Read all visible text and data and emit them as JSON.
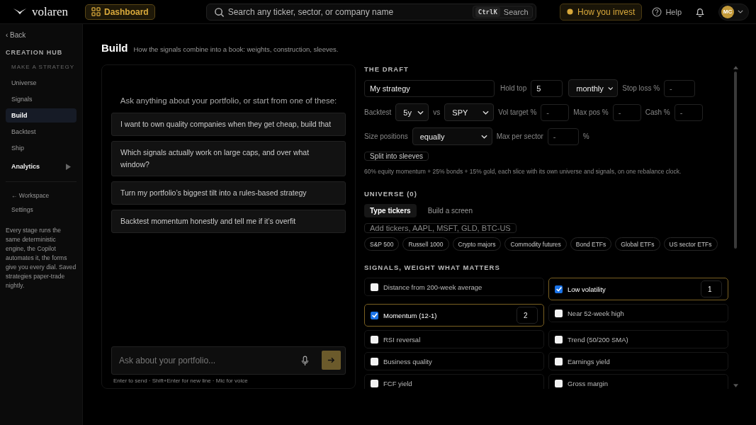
{
  "topbar": {
    "brand": "volaren",
    "dashboard_button": "Dashboard",
    "search": {
      "placeholder": "Search any ticker, sector, or company name",
      "shortcut": "CtrlK",
      "shortcut_label": "Search"
    },
    "invest_button": "How you invest",
    "help": "Help",
    "avatar": "MC"
  },
  "sidebar": {
    "back": "‹ Back",
    "section": "CREATION HUB",
    "subsection": "MAKE A STRATEGY",
    "items": [
      {
        "label": "Universe",
        "selected": false
      },
      {
        "label": "Signals",
        "selected": false
      },
      {
        "label": "Build",
        "selected": true
      },
      {
        "label": "Backtest",
        "selected": false
      },
      {
        "label": "Ship",
        "selected": false
      }
    ],
    "analytics": "Analytics",
    "links": [
      "← Workspace",
      "Settings"
    ],
    "note": "Every stage runs the same deterministic engine, the Copilot automates it, the forms give you every dial. Saved strategies paper-trade nightly."
  },
  "page": {
    "title": "Build",
    "subtitle": "How the signals combine into a book: weights, construction, sleeves."
  },
  "chat": {
    "intro": "Ask anything about your portfolio, or start from one of these:",
    "suggestions": [
      "I want to own quality companies when they get cheap, build that",
      "Which signals actually work on large caps, and over what window?",
      "Turn my portfolio’s biggest tilt into a rules-based strategy",
      "Backtest momentum honestly and tell me if it’s overfit"
    ],
    "input": {
      "placeholder": "Ask about your portfolio..."
    },
    "hint": "Enter to send · Shift+Enter for new line · Mic for voice"
  },
  "draft": {
    "heading": "THE DRAFT",
    "name": {
      "value": "My strategy"
    },
    "hold_top": {
      "label": "Hold top",
      "value": "5"
    },
    "rebalance": {
      "value": "monthly"
    },
    "stop_loss": {
      "label": "Stop loss %",
      "placeholder": "-"
    },
    "backtest": {
      "label": "Backtest",
      "value": "5y"
    },
    "vs": "vs",
    "benchmark": {
      "value": "SPY"
    },
    "vol_target": {
      "label": "Vol target %",
      "placeholder": "-"
    },
    "max_pos": {
      "label": "Max pos %",
      "placeholder": "-"
    },
    "cash": {
      "label": "Cash %",
      "placeholder": "-"
    },
    "size_positions": {
      "label": "Size positions",
      "value": "equally"
    },
    "max_per_sector": {
      "label": "Max per sector",
      "placeholder": "-",
      "suffix": "%"
    },
    "sleeves_button": "Split into sleeves",
    "sleeves_note": "60% equity momentum + 25% bonds + 15% gold, each slice with its own universe and signals, on one rebalance clock."
  },
  "universe": {
    "heading": "UNIVERSE (0)",
    "tabs": [
      {
        "label": "Type tickers",
        "selected": true
      },
      {
        "label": "Build a screen",
        "selected": false
      }
    ],
    "tickers": {
      "placeholder": "Add tickers, AAPL, MSFT, GLD, BTC-US"
    },
    "presets": [
      "S&P 500",
      "Russell 1000",
      "Crypto majors",
      "Commodity futures",
      "Bond ETFs",
      "Global ETFs",
      "US sector ETFs"
    ]
  },
  "signals": {
    "heading": "SIGNALS, WEIGHT WHAT MATTERS",
    "items": [
      {
        "label": "Distance from 200-week average",
        "checked": false
      },
      {
        "label": "Low volatility",
        "checked": true,
        "weight": "1"
      },
      {
        "label": "Momentum (12-1)",
        "checked": true,
        "weight": "2"
      },
      {
        "label": "Near 52-week high",
        "checked": false
      },
      {
        "label": "RSI reversal",
        "checked": false
      },
      {
        "label": "Trend (50/200 SMA)",
        "checked": false
      },
      {
        "label": "Business quality",
        "checked": false
      },
      {
        "label": "Earnings yield",
        "checked": false
      },
      {
        "label": "FCF yield",
        "checked": false
      },
      {
        "label": "Gross margin",
        "checked": false
      }
    ]
  }
}
